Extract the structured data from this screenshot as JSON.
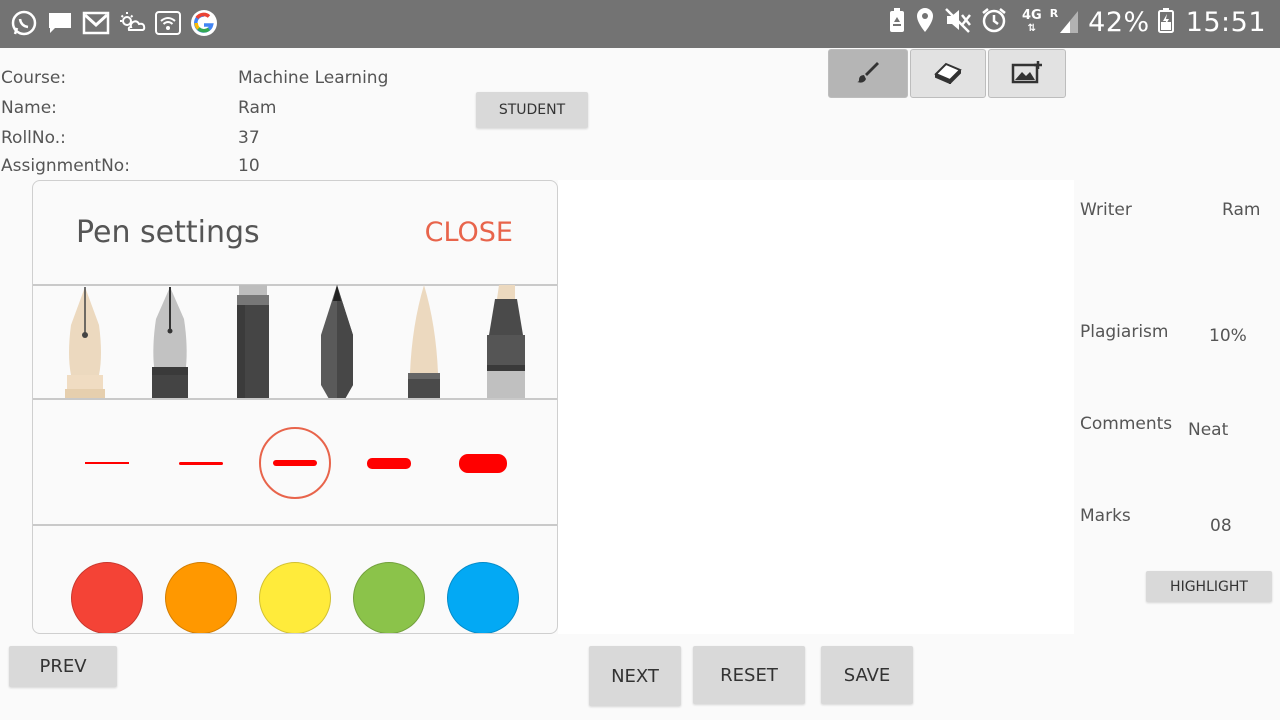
{
  "statusbar": {
    "network": "4G",
    "roaming": "R",
    "battery": "42%",
    "time": "15:51",
    "left_icons": [
      "whatsapp-icon",
      "message-icon",
      "gmail-icon",
      "weather-icon",
      "wifi-icon",
      "google-icon"
    ],
    "right_icons": [
      "battery-saver-icon",
      "location-icon",
      "mute-icon",
      "alarm-icon",
      "signal-icon",
      "battery-icon"
    ]
  },
  "info": {
    "course_label": "Course:",
    "course_value": "Machine Learning",
    "name_label": "Name:",
    "name_value": "Ram",
    "rollno_label": "RollNo.:",
    "rollno_value": "37",
    "assignment_label": "AssignmentNo:",
    "assignment_value": "10"
  },
  "buttons": {
    "student": "STUDENT",
    "highlight": "HIGHLIGHT",
    "prev": "PREV",
    "next": "NEXT",
    "reset": "RESET",
    "save": "SAVE"
  },
  "toolbar": {
    "tools": [
      "brush-icon",
      "eraser-icon",
      "add-image-icon"
    ],
    "active_tool": "brush-icon"
  },
  "right_panel": {
    "writer_label": "Writer",
    "writer_value": "Ram",
    "plagiarism_label": "Plagiarism",
    "plagiarism_value": "10%",
    "comments_label": "Comments",
    "comments_value": "Neat",
    "marks_label": "Marks",
    "marks_value": "08"
  },
  "pen_settings": {
    "title": "Pen settings",
    "close_label": "CLOSE",
    "pens": [
      "fountain-pen-cream-icon",
      "fountain-pen-silver-icon",
      "marker-icon",
      "pencil-icon",
      "brush-pen-icon",
      "highlighter-icon"
    ],
    "stroke_sizes": [
      "extra-fine",
      "fine",
      "medium",
      "thick",
      "extra-thick"
    ],
    "selected_stroke": "medium",
    "stroke_color": "#ff0000",
    "colors": [
      "#f44336",
      "#ff9800",
      "#ffeb3b",
      "#8bc34a",
      "#03a9f4"
    ],
    "accent": "#e8644b"
  }
}
